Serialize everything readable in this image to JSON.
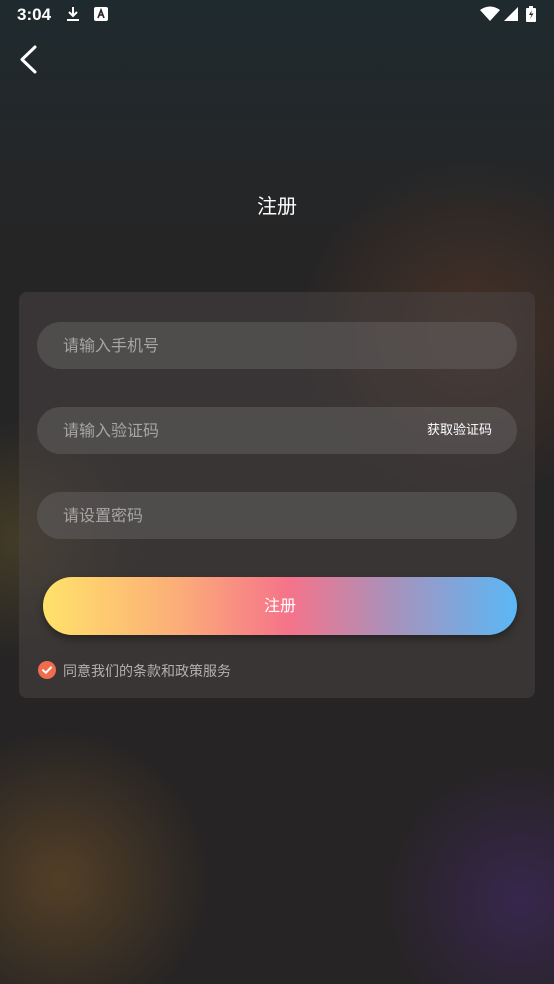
{
  "status_bar": {
    "time": "3:04",
    "left_icons": [
      "download-icon",
      "a-badge-icon"
    ],
    "right_icons": [
      "wifi-icon",
      "signal-icon",
      "battery-icon"
    ]
  },
  "header": {
    "back_icon": "chevron-left-icon",
    "title": "注册"
  },
  "form": {
    "phone_placeholder": "请输入手机号",
    "code_placeholder": "请输入验证码",
    "get_code_label": "获取验证码",
    "password_placeholder": "请设置密码",
    "register_label": "注册",
    "agree_text": "同意我们的条款和政策服务",
    "agree_checked": true
  },
  "colors": {
    "check_accent": "#ee6d4e",
    "button_gradient": [
      "#ffe26a",
      "#f5738a",
      "#5ab8f6"
    ]
  }
}
